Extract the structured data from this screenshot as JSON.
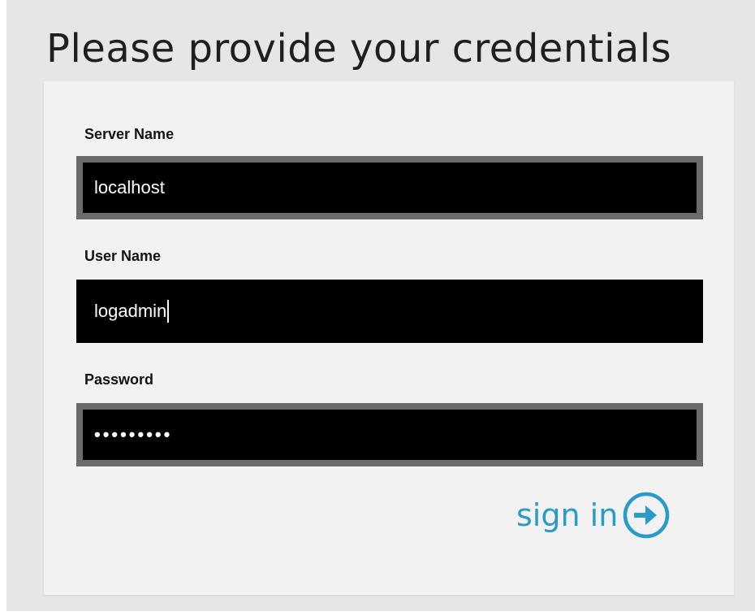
{
  "page": {
    "title": "Please provide your credentials"
  },
  "form": {
    "server": {
      "label": "Server Name",
      "value": "localhost"
    },
    "user": {
      "label": "User Name",
      "value": "logadmin"
    },
    "password": {
      "label": "Password",
      "masked_value": "•••••••••"
    },
    "submit": {
      "label": "sign in",
      "icon": "arrow-right-circle-icon"
    }
  },
  "colors": {
    "accent": "#2a9ac9",
    "field_background": "#000000",
    "field_border": "#6b6b6b",
    "panel_background": "#f2f2f2",
    "page_background": "#e6e6e6"
  }
}
